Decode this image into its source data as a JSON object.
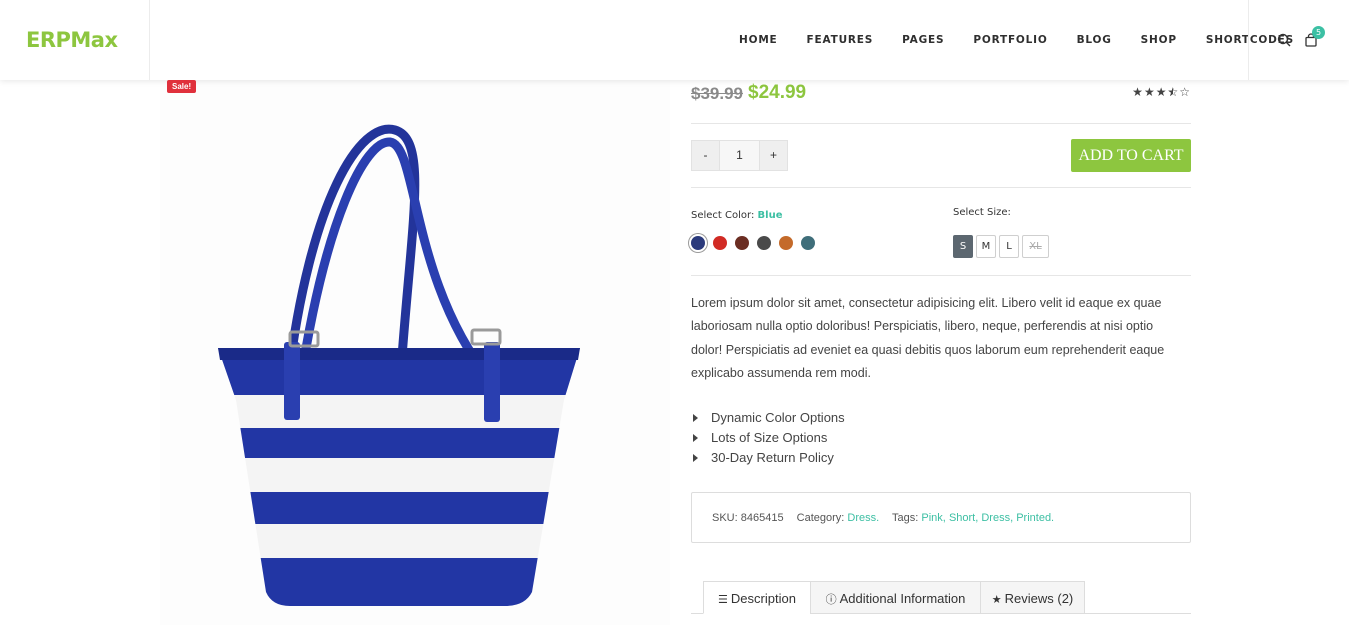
{
  "header": {
    "logo": "ERPMax",
    "nav": [
      "HOME",
      "FEATURES",
      "PAGES",
      "PORTFOLIO",
      "BLOG",
      "SHOP",
      "SHORTCODES"
    ],
    "cart_count": "5",
    "icons": [
      "search-icon",
      "cart-icon"
    ]
  },
  "product": {
    "sale_badge": "Sale!",
    "old_price": "$39.99",
    "new_price": "$24.99",
    "rating": 3.5,
    "rating_max": 5,
    "quantity": "1",
    "qty_minus": "-",
    "qty_plus": "+",
    "add_to_cart": "ADD TO CART",
    "color_label": "Select Color:",
    "color_selected": "Blue",
    "colors": [
      "#2b3a7c",
      "#d12b24",
      "#6b2d22",
      "#4a4a4a",
      "#c46a2a",
      "#3f6e7a"
    ],
    "size_label": "Select Size:",
    "sizes": [
      "S",
      "M",
      "L",
      "XL"
    ],
    "description": "Lorem ipsum dolor sit amet, consectetur adipisicing elit. Libero velit id eaque ex quae laboriosam nulla optio doloribus! Perspiciatis, libero, neque, perferendis at nisi optio dolor! Perspiciatis ad eveniet ea quasi debitis quos laborum eum reprehenderit eaque explicabo assumenda rem modi.",
    "features": [
      "Dynamic Color Options",
      "Lots of Size Options",
      "30-Day Return Policy"
    ],
    "meta": {
      "sku_label": "SKU:",
      "sku": "8465415",
      "category_label": "Category:",
      "category": "Dress.",
      "tags_label": "Tags:",
      "tags": [
        "Pink,",
        "Short,",
        "Dress,",
        "Printed."
      ]
    },
    "tabs": [
      "Description",
      "Additional Information",
      "Reviews (2)"
    ]
  },
  "colors": {
    "accent_green": "#8dc63f",
    "accent_teal": "#3cbfa3",
    "sale_red": "#e0303c"
  }
}
